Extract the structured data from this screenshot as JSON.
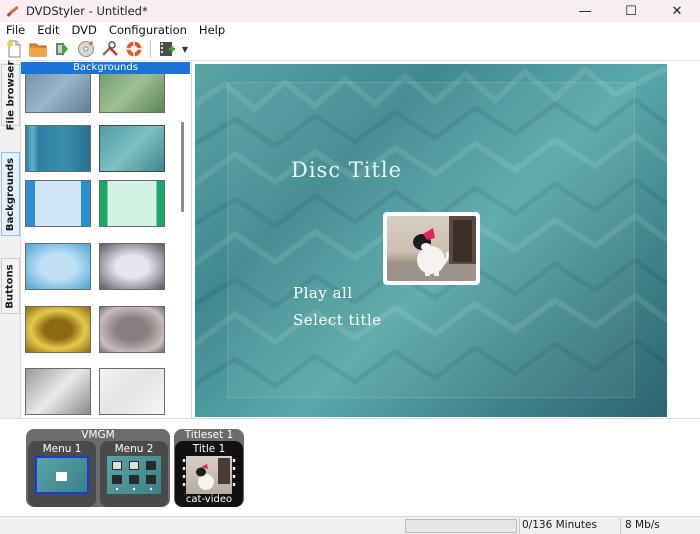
{
  "window": {
    "title": "DVDStyler - Untitled*",
    "minimize": "—",
    "maximize": "☐",
    "close": "✕"
  },
  "menu": [
    "File",
    "Edit",
    "DVD",
    "Configuration",
    "Help"
  ],
  "toolbar": {
    "icons": [
      "new-icon",
      "open-icon",
      "save-icon",
      "burn-icon",
      "settings-icon",
      "help-icon",
      "add-file-icon"
    ]
  },
  "tabs": [
    {
      "label": "File browser"
    },
    {
      "label": "Backgrounds"
    },
    {
      "label": "Buttons"
    }
  ],
  "backgrounds": {
    "header": "Backgrounds"
  },
  "preview": {
    "title": "Disc Title",
    "buttons": [
      "Play all",
      "Select title"
    ]
  },
  "vmgm": {
    "label": "VMGM",
    "menus": [
      {
        "label": "Menu 1"
      },
      {
        "label": "Menu 2"
      }
    ]
  },
  "titleset": {
    "label": "Titleset 1",
    "titles": [
      {
        "label": "Title 1",
        "file": "cat-video"
      }
    ]
  },
  "status": {
    "minutes": "0/136 Minutes",
    "bitrate": "8 Mb/s"
  }
}
